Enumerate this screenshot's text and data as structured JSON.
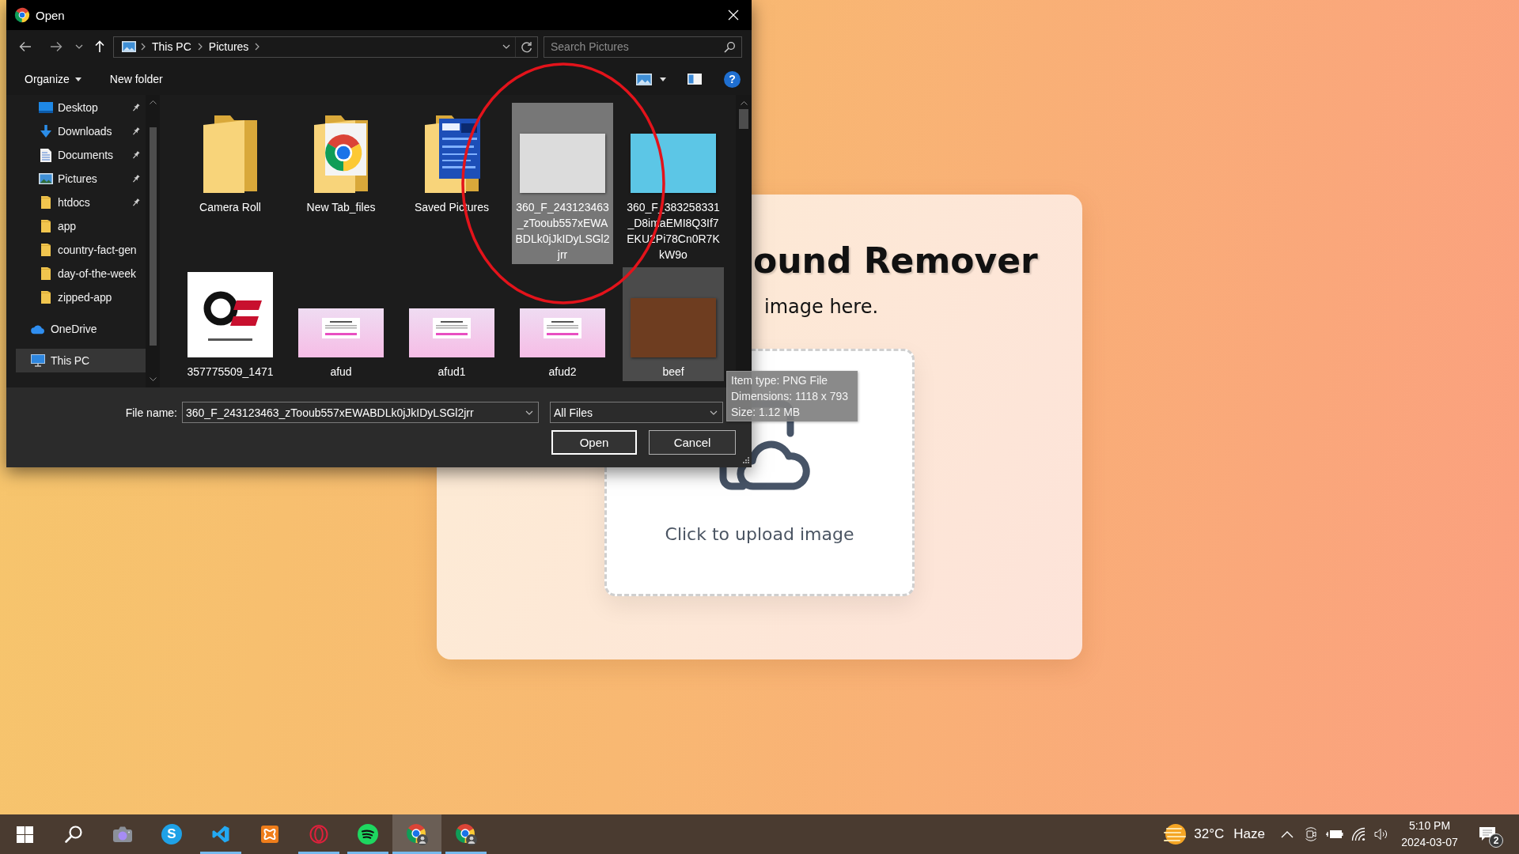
{
  "page": {
    "title": "ound Remover",
    "subtitle": "image here.",
    "upload_label": "Click to upload image"
  },
  "dialog": {
    "title": "Open",
    "address": {
      "crumbs": [
        "This PC",
        "Pictures"
      ]
    },
    "search": {
      "placeholder": "Search Pictures"
    },
    "toolbar": [
      {
        "label": "Organize",
        "kind": "menu"
      },
      {
        "label": "New folder",
        "kind": "button"
      }
    ],
    "help": "?",
    "sidebar": {
      "items": [
        {
          "label": "Desktop",
          "kind": "desktop",
          "pinned": true,
          "selected": false
        },
        {
          "label": "Downloads",
          "kind": "downloads",
          "pinned": true,
          "selected": false
        },
        {
          "label": "Documents",
          "kind": "documents",
          "pinned": true,
          "selected": false
        },
        {
          "label": "Pictures",
          "kind": "pictures",
          "pinned": true,
          "selected": false
        },
        {
          "label": "htdocs",
          "kind": "folder",
          "pinned": true,
          "selected": false
        },
        {
          "label": "app",
          "kind": "folder",
          "pinned": false,
          "selected": false
        },
        {
          "label": "country-fact-gen",
          "kind": "folder",
          "pinned": false,
          "selected": false
        },
        {
          "label": "day-of-the-week",
          "kind": "folder",
          "pinned": false,
          "selected": false
        },
        {
          "label": "zipped-app",
          "kind": "folder",
          "pinned": false,
          "selected": false
        },
        {
          "label": "OneDrive",
          "kind": "cloud",
          "pinned": false,
          "selected": false
        },
        {
          "label": "This PC",
          "kind": "computer",
          "pinned": false,
          "selected": true
        }
      ]
    },
    "files": [
      {
        "name": "Camera Roll",
        "kind": "folder",
        "selected": false,
        "hovered": false
      },
      {
        "name": "New Tab_files",
        "kind": "appfolder",
        "selected": false,
        "hovered": false
      },
      {
        "name": "Saved Pictures",
        "kind": "imagefolder",
        "selected": false,
        "hovered": false
      },
      {
        "name": "360_F_243123463_zTooub557xEWABDLk0jJkIDyLSGl2jrr",
        "kind": "photo",
        "color": "#dcdcdc",
        "selected": true,
        "hovered": false
      },
      {
        "name": "360_F_383258331_D8imaEMI8Q3If7EKU2Pi78Cn0R7KkW9o",
        "kind": "photo",
        "color": "#5cc6e6",
        "selected": false,
        "hovered": false
      },
      {
        "name": "357775509_1471",
        "kind": "logo",
        "selected": false,
        "hovered": false
      },
      {
        "name": "afud",
        "kind": "screenshot",
        "selected": false,
        "hovered": false
      },
      {
        "name": "afud1",
        "kind": "screenshot",
        "selected": false,
        "hovered": false
      },
      {
        "name": "afud2",
        "kind": "screenshot",
        "selected": false,
        "hovered": false
      },
      {
        "name": "beef",
        "kind": "photo",
        "color": "#6e3d20",
        "selected": false,
        "hovered": true
      }
    ],
    "file_name": {
      "label": "File name:",
      "value": "360_F_243123463_zTooub557xEWABDLk0jJkIDyLSGl2jrr"
    },
    "file_type": {
      "value": "All Files"
    },
    "buttons": [
      {
        "label": "Open",
        "default": true
      },
      {
        "label": "Cancel",
        "default": false
      }
    ]
  },
  "tooltip": {
    "lines": [
      "Item type: PNG File",
      "Dimensions: 1118 x 793",
      "Size: 1.12 MB"
    ]
  },
  "taskbar": {
    "apps": [
      {
        "kind": "start",
        "running": false,
        "selected": false
      },
      {
        "kind": "search",
        "running": false,
        "selected": false
      },
      {
        "kind": "camera",
        "running": false,
        "selected": false
      },
      {
        "kind": "messenger",
        "label": "S",
        "running": false,
        "selected": false
      },
      {
        "kind": "editor",
        "running": true,
        "selected": false
      },
      {
        "kind": "server",
        "running": false,
        "selected": false
      },
      {
        "kind": "ringbrowser",
        "running": true,
        "selected": false
      },
      {
        "kind": "music",
        "running": true,
        "selected": false
      },
      {
        "kind": "browser",
        "running": true,
        "selected": true
      },
      {
        "kind": "browser",
        "running": true,
        "selected": false
      }
    ],
    "weather": {
      "temperature": "32°C",
      "condition": "Haze"
    },
    "clock": {
      "time": "5:10 PM",
      "date": "2024-03-07"
    },
    "notifications": {
      "count": "2"
    }
  }
}
